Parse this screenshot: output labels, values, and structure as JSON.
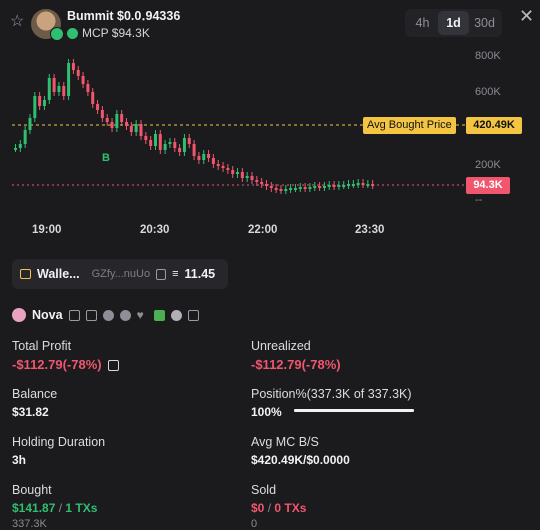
{
  "header": {
    "token_name": "Bummit $0.0․94336",
    "mcp_label": "MCP $94.3K",
    "timeframes": [
      {
        "label": "4h",
        "active": false
      },
      {
        "label": "1d",
        "active": true
      },
      {
        "label": "30d",
        "active": false
      }
    ],
    "close_icon": "close-icon",
    "favorite_icon": "star-icon"
  },
  "chart_data": {
    "type": "candlestick",
    "y_tick_labels": [
      "800K",
      "600K",
      "200K",
      "--"
    ],
    "x_tick_labels": [
      "19:00",
      "20:30",
      "22:00",
      "23:30"
    ],
    "avg_bought_label": "Avg Bought Price",
    "avg_bought_value": "420.49K",
    "current_value": "94.3K",
    "buy_marker": "B",
    "colors": {
      "up": "#2fbf71",
      "down": "#f0566d",
      "avg_line": "#f4c542",
      "current_line": "#f0566d"
    }
  },
  "wallet": {
    "label": "Walle...",
    "address": "GZfy...nuUo",
    "count": "11.45"
  },
  "trader": {
    "name": "Nova"
  },
  "stats": {
    "total_profit": {
      "label": "Total Profit",
      "value": "-$112.79(-78%)"
    },
    "unrealized": {
      "label": "Unrealized",
      "value": "-$112.79(-78%)"
    },
    "balance": {
      "label": "Balance",
      "value": "$31.82"
    },
    "position": {
      "label": "Position%(337.3K of 337.3K)",
      "value": "100%",
      "fill_percent": 100
    },
    "holding": {
      "label": "Holding Duration",
      "value": "3h"
    },
    "avg_mc": {
      "label": "Avg MC B/S",
      "value": "$420.49K/$0.0000"
    },
    "bought": {
      "label": "Bought",
      "amount": "$141.87",
      "sep": "/",
      "txs": "1 TXs",
      "sub": "337.3K"
    },
    "sold": {
      "label": "Sold",
      "amount": "$0",
      "sep": "/",
      "txs": "0 TXs",
      "sub": "0"
    }
  }
}
